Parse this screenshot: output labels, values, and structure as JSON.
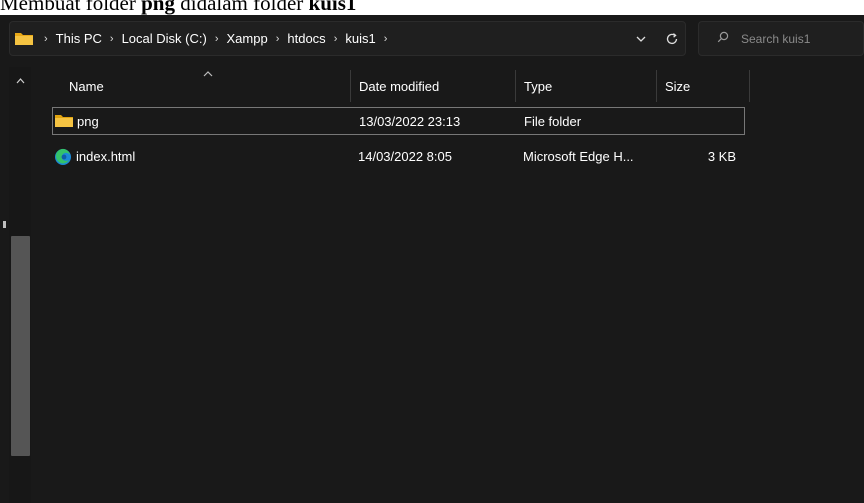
{
  "caption": {
    "prefix": "Membuat folder ",
    "bold1": "png",
    "middle": " didalam folder ",
    "bold2": "kuis1"
  },
  "address_bar": {
    "breadcrumbs": [
      "This PC",
      "Local Disk (C:)",
      "Xampp",
      "htdocs",
      "kuis1"
    ]
  },
  "search": {
    "placeholder": "Search kuis1"
  },
  "columns": {
    "name": "Name",
    "date_modified": "Date modified",
    "type": "Type",
    "size": "Size",
    "sorted_by": "Name"
  },
  "files": [
    {
      "name": "png",
      "date_modified": "13/03/2022 23:13",
      "type": "File folder",
      "size": "",
      "icon": "folder-icon",
      "selected": true
    },
    {
      "name": "index.html",
      "date_modified": "14/03/2022 8:05",
      "type": "Microsoft Edge H...",
      "size": "3 KB",
      "icon": "edge-icon",
      "selected": false
    }
  ],
  "colors": {
    "background": "#191919",
    "folder": "#f5c342",
    "text": "#ffffff",
    "scroll_thumb": "#555555"
  }
}
